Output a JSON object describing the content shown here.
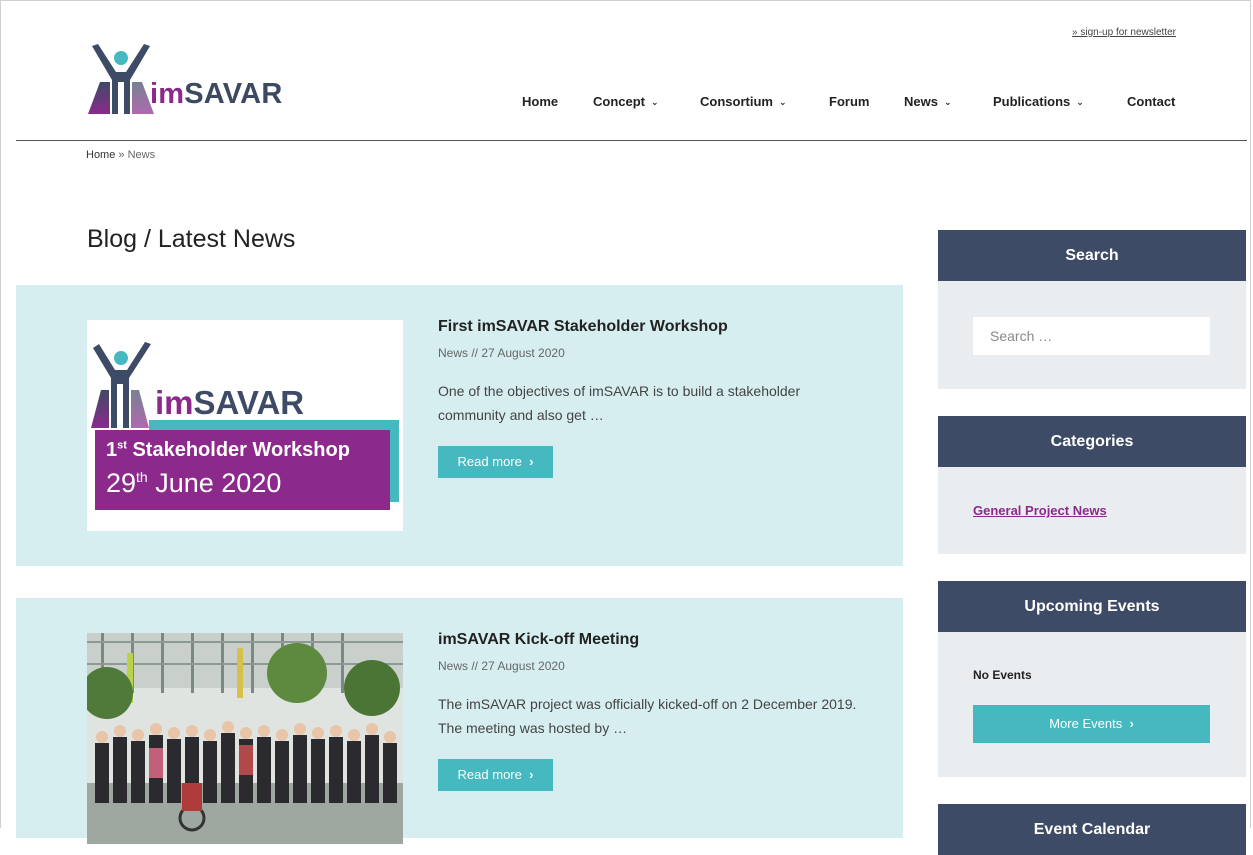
{
  "header": {
    "newsletter_link": "» sign-up for newsletter",
    "logo_text_im": "im",
    "logo_text_savar": "SAVAR"
  },
  "nav": {
    "home": "Home",
    "concept": "Concept",
    "consortium": "Consortium",
    "forum": "Forum",
    "news": "News",
    "publications": "Publications",
    "contact": "Contact",
    "chevron": "⌄"
  },
  "breadcrumb": {
    "home": "Home",
    "separator": " » ",
    "current": "News"
  },
  "page_title": "Blog / Latest News",
  "posts": [
    {
      "title": "First imSAVAR Stakeholder Workshop",
      "meta": "News // 27 August 2020",
      "excerpt": "One of the objectives of imSAVAR is to build a stakeholder community and also get …",
      "button": "Read more",
      "button_icon": "›",
      "thumb": {
        "logo_im": "im",
        "logo_savar": "SAVAR",
        "line1_prefix": "1",
        "line1_sup": "st",
        "line1_rest": " Stakeholder Workshop",
        "line2_prefix": "29",
        "line2_sup": "th",
        "line2_rest": " June 2020"
      }
    },
    {
      "title": "imSAVAR Kick-off Meeting",
      "meta": "News // 27 August 2020",
      "excerpt": "The imSAVAR project was officially kicked-off on 2 December 2019. The meeting was hosted by …",
      "button": "Read more",
      "button_icon": "›"
    }
  ],
  "sidebar": {
    "search": {
      "title": "Search",
      "placeholder": "Search …"
    },
    "categories": {
      "title": "Categories",
      "items": [
        "General Project News"
      ]
    },
    "events": {
      "title": "Upcoming Events",
      "empty_text": "No Events",
      "button": "More Events",
      "button_icon": "›"
    },
    "calendar": {
      "title": "Event Calendar"
    }
  },
  "colors": {
    "brand_navy": "#3e4b66",
    "brand_purple": "#8b2a8b",
    "accent_teal": "#45b8c0",
    "post_bg": "#d7eef1",
    "widget_bg": "#eaedf0"
  }
}
